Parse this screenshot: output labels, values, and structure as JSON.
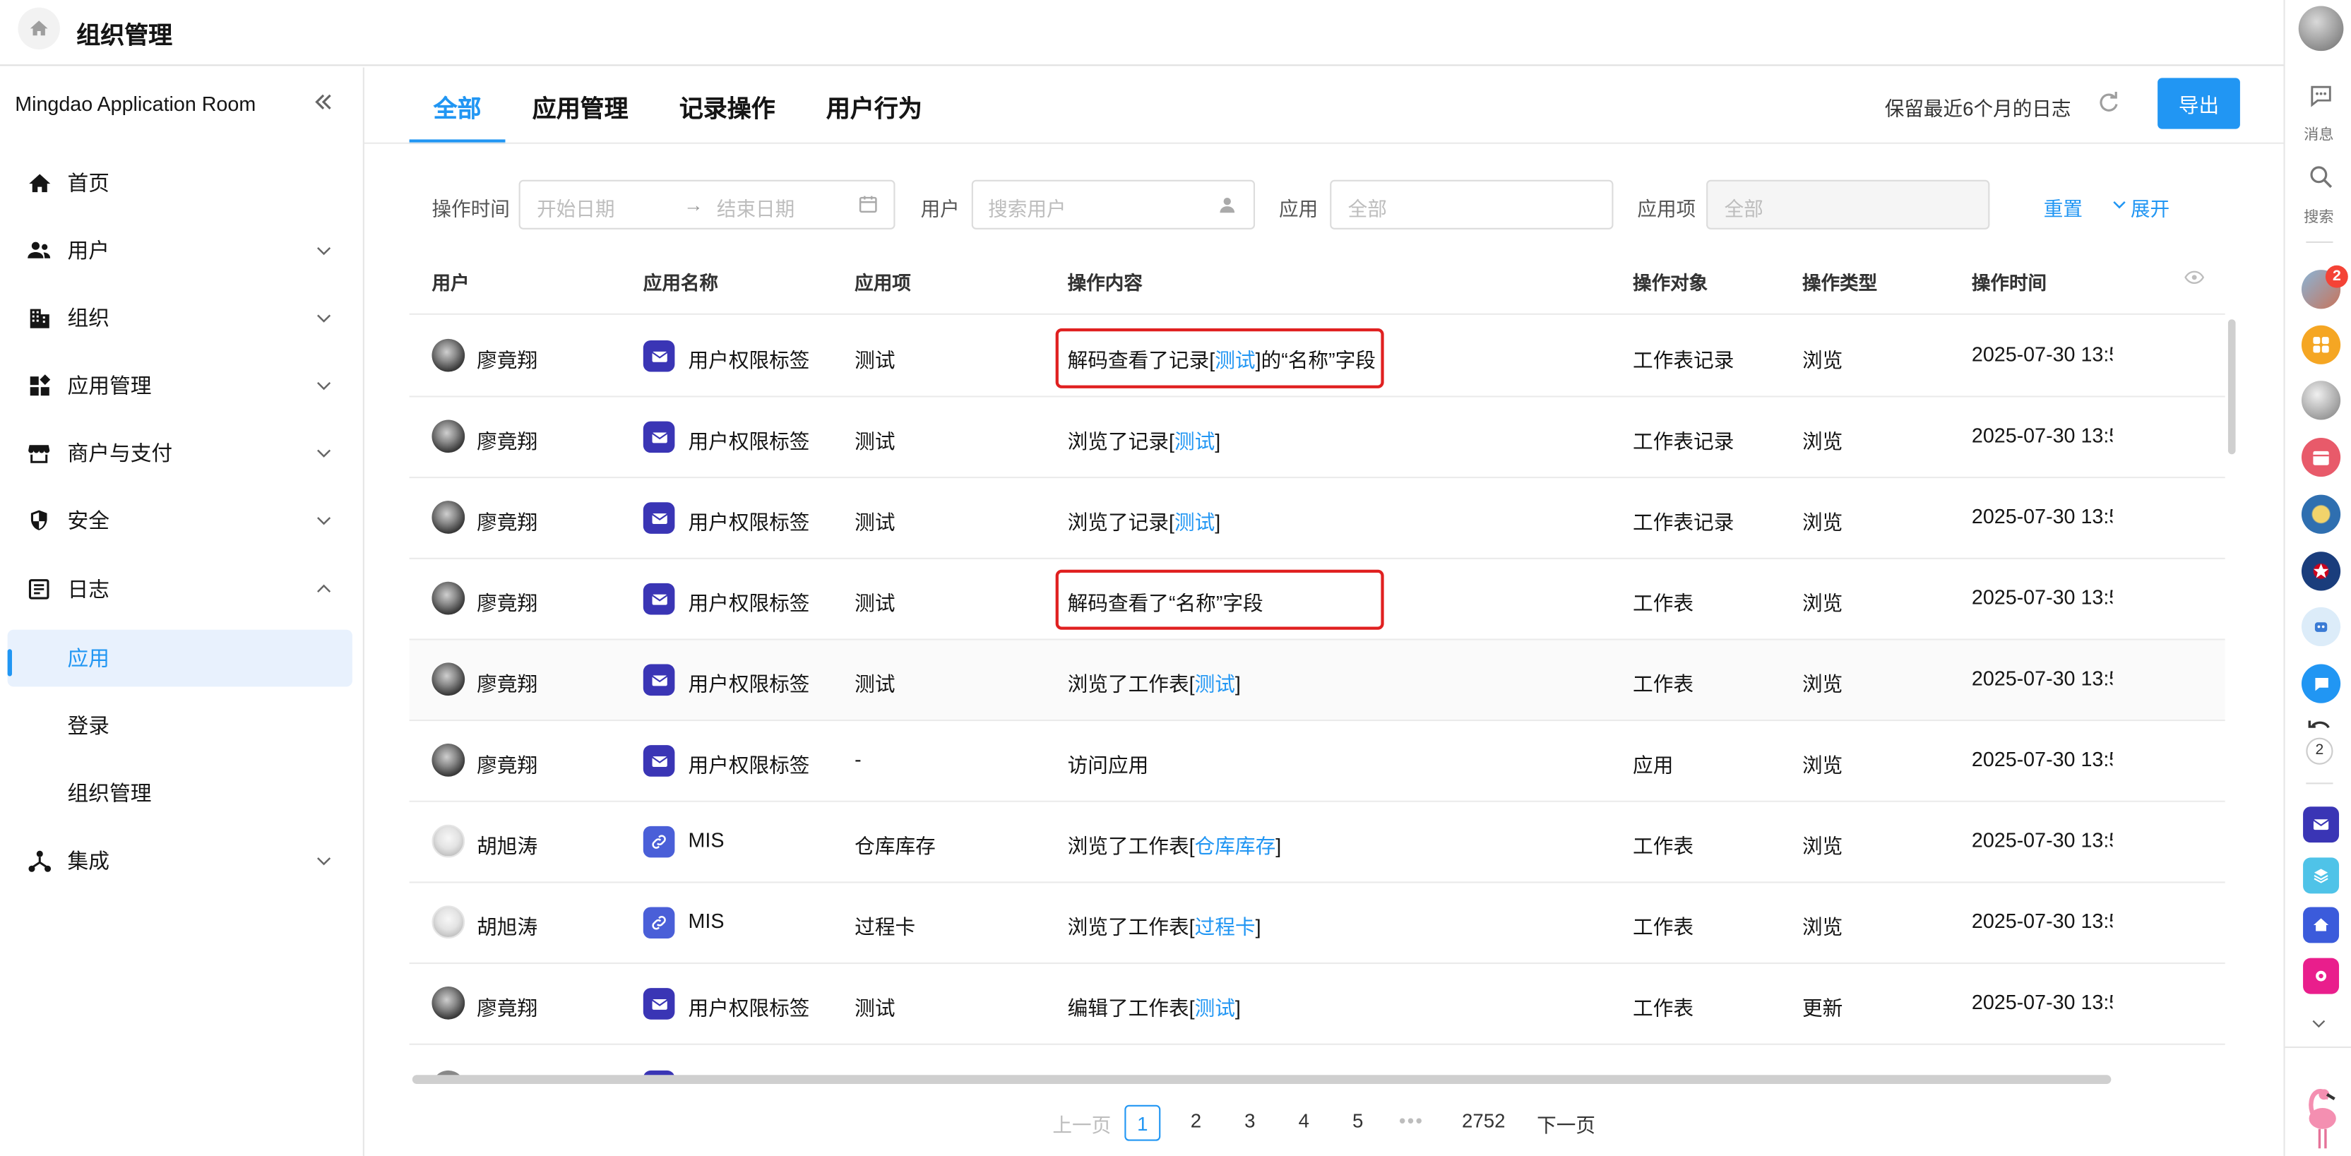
{
  "header": {
    "title": "组织管理"
  },
  "sidebar": {
    "org_name": "Mingdao Application Room",
    "items": [
      {
        "label": "首页",
        "icon": "home-icon"
      },
      {
        "label": "用户",
        "icon": "users-icon"
      },
      {
        "label": "组织",
        "icon": "building-icon"
      },
      {
        "label": "应用管理",
        "icon": "apps-icon"
      },
      {
        "label": "商户与支付",
        "icon": "store-icon"
      },
      {
        "label": "安全",
        "icon": "shield-icon"
      },
      {
        "label": "日志",
        "icon": "log-icon"
      },
      {
        "label": "集成",
        "icon": "integration-icon"
      }
    ],
    "log_subitems": [
      "应用",
      "登录",
      "组织管理"
    ]
  },
  "tabs": [
    "全部",
    "应用管理",
    "记录操作",
    "用户行为"
  ],
  "toolbar": {
    "retain_text": "保留最近6个月的日志",
    "export_label": "导出"
  },
  "filters": {
    "time_label": "操作时间",
    "start_placeholder": "开始日期",
    "arrow": "→",
    "end_placeholder": "结束日期",
    "user_label": "用户",
    "user_placeholder": "搜索用户",
    "app_label": "应用",
    "app_placeholder": "全部",
    "item_label": "应用项",
    "item_placeholder": "全部",
    "reset": "重置",
    "expand": "展开"
  },
  "table": {
    "columns": [
      "用户",
      "应用名称",
      "应用项",
      "操作内容",
      "操作对象",
      "操作类型",
      "操作时间"
    ],
    "rows": [
      {
        "user": "廖竟翔",
        "avatar": "dark",
        "app": "用户权限标签",
        "app_icon": "purple",
        "item": "测试",
        "content_pre": "解码查看了记录[",
        "content_link": "测试",
        "content_post": "]的“名称”字段",
        "object": "工作表记录",
        "type": "浏览",
        "time": "2025-07-30 13:5"
      },
      {
        "user": "廖竟翔",
        "avatar": "dark",
        "app": "用户权限标签",
        "app_icon": "purple",
        "item": "测试",
        "content_pre": "浏览了记录[",
        "content_link": "测试",
        "content_post": "]",
        "object": "工作表记录",
        "type": "浏览",
        "time": "2025-07-30 13:5"
      },
      {
        "user": "廖竟翔",
        "avatar": "dark",
        "app": "用户权限标签",
        "app_icon": "purple",
        "item": "测试",
        "content_pre": "浏览了记录[",
        "content_link": "测试",
        "content_post": "]",
        "object": "工作表记录",
        "type": "浏览",
        "time": "2025-07-30 13:5"
      },
      {
        "user": "廖竟翔",
        "avatar": "dark",
        "app": "用户权限标签",
        "app_icon": "purple",
        "item": "测试",
        "content_pre": "解码查看了“名称”字段",
        "content_link": "",
        "content_post": "",
        "object": "工作表",
        "type": "浏览",
        "time": "2025-07-30 13:5"
      },
      {
        "user": "廖竟翔",
        "avatar": "dark",
        "app": "用户权限标签",
        "app_icon": "purple",
        "item": "测试",
        "content_pre": "浏览了工作表[",
        "content_link": "测试",
        "content_post": "]",
        "object": "工作表",
        "type": "浏览",
        "time": "2025-07-30 13:5"
      },
      {
        "user": "廖竟翔",
        "avatar": "dark",
        "app": "用户权限标签",
        "app_icon": "purple",
        "item": "-",
        "content_pre": "访问应用",
        "content_link": "",
        "content_post": "",
        "object": "应用",
        "type": "浏览",
        "time": "2025-07-30 13:5"
      },
      {
        "user": "胡旭涛",
        "avatar": "light",
        "app": "MIS",
        "app_icon": "blue",
        "item": "仓库库存",
        "content_pre": "浏览了工作表[",
        "content_link": "仓库库存",
        "content_post": "]",
        "object": "工作表",
        "type": "浏览",
        "time": "2025-07-30 13:5"
      },
      {
        "user": "胡旭涛",
        "avatar": "light",
        "app": "MIS",
        "app_icon": "blue",
        "item": "过程卡",
        "content_pre": "浏览了工作表[",
        "content_link": "过程卡",
        "content_post": "]",
        "object": "工作表",
        "type": "浏览",
        "time": "2025-07-30 13:5"
      },
      {
        "user": "廖竟翔",
        "avatar": "dark",
        "app": "用户权限标签",
        "app_icon": "purple",
        "item": "测试",
        "content_pre": "编辑了工作表[",
        "content_link": "测试",
        "content_post": "]",
        "object": "工作表",
        "type": "更新",
        "time": "2025-07-30 13:5"
      }
    ]
  },
  "pagination": {
    "prev": "上一页",
    "pages": [
      "1",
      "2",
      "3",
      "4",
      "5"
    ],
    "ellipsis": "•••",
    "last": "2752",
    "next": "下一页",
    "current": "1"
  },
  "rail": {
    "messages_label": "消息",
    "search_label": "搜索",
    "badge_count": "2",
    "undo_count": "2"
  },
  "colors": {
    "accent": "#2196f3",
    "highlight_border": "#e02020",
    "app_purple": "#3a35b5",
    "app_blue": "#4a5fd8"
  }
}
